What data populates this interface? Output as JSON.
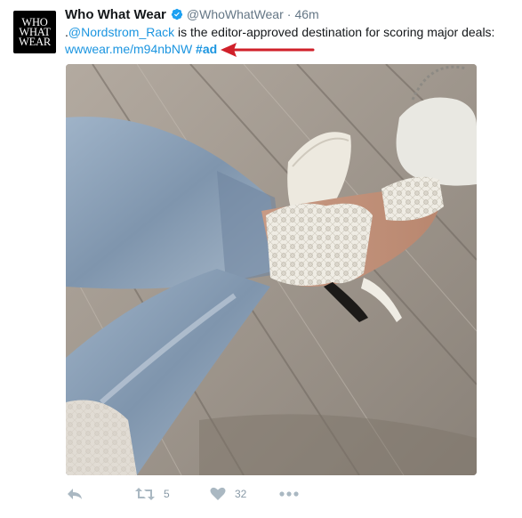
{
  "tweet": {
    "avatar_lines": [
      "WHO",
      "WHAT",
      "WEAR"
    ],
    "display_name": "Who What Wear",
    "handle": "@WhoWhatWear",
    "separator": "·",
    "time": "46m",
    "text_prefix": ".",
    "mention": "@Nordstrom_Rack",
    "text_body": " is the editor-approved destination for scoring major deals:",
    "link": "wwwear.me/m94nbNW",
    "hashtag": "#ad",
    "colors": {
      "link": "#1b95e0",
      "arrow": "#d0202a",
      "verified": "#1da1f2",
      "muted": "#8899a6"
    }
  },
  "actions": {
    "retweet_count": "5",
    "like_count": "32",
    "icons": [
      "reply-icon",
      "retweet-icon",
      "heart-icon",
      "more-icon"
    ]
  }
}
